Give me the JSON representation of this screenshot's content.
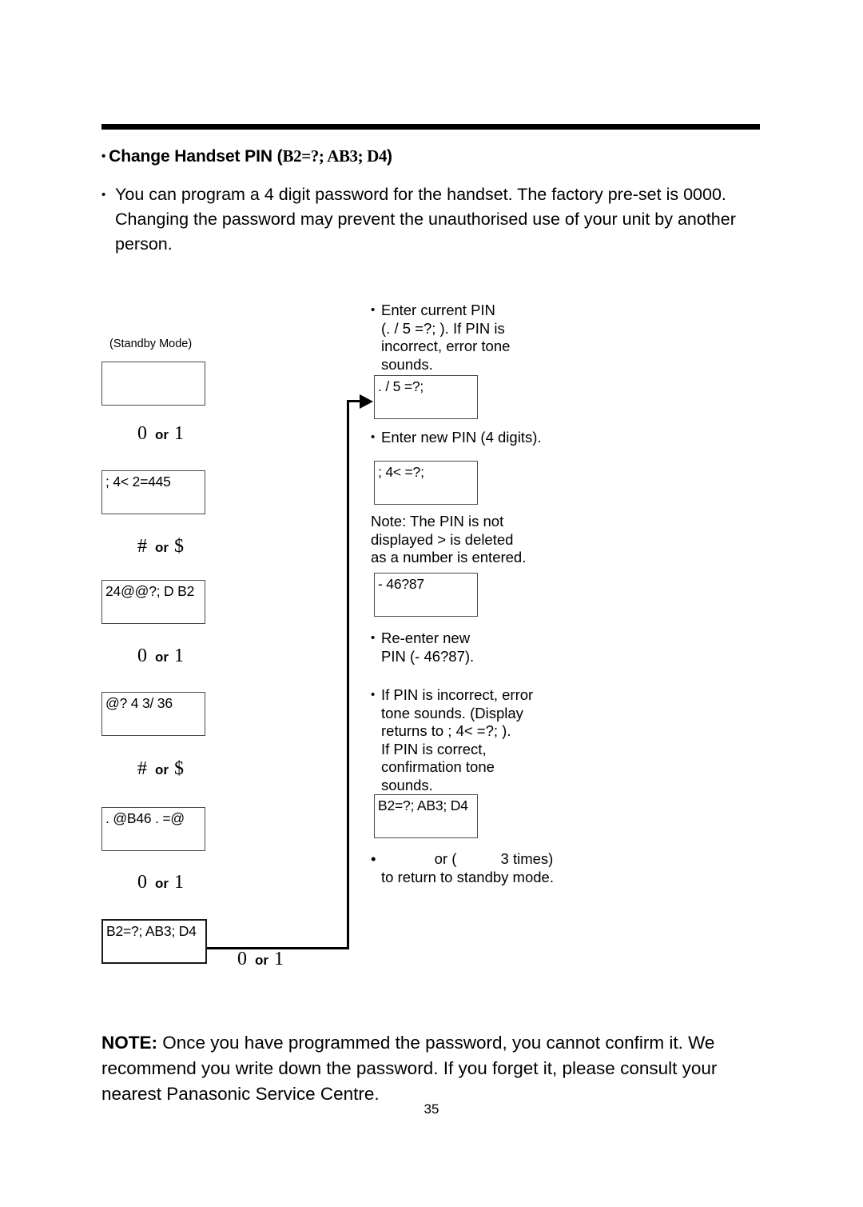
{
  "document": {
    "page_number": "35"
  },
  "header": {
    "bullet": "•",
    "title_prefix": "Change Handset PIN (",
    "title_symbols": "B2=?;   AB3; D4",
    "title_suffix": ")"
  },
  "intro": {
    "bullet": "•",
    "text": "You can program a 4 digit password for the handset. The factory pre-set is 0000. Changing the password may prevent the unauthorised use of your unit by another person."
  },
  "diagram": {
    "standby_label": "(Standby Mode)",
    "left_column": {
      "displays": [
        {
          "name": "standby-display",
          "text": ""
        },
        {
          "name": "menu-display",
          "text": "; 4< 2=445"
        },
        {
          "name": "option-display",
          "text": "24@@?; D B2"
        },
        {
          "name": "setting-display",
          "text": "@?  4 3/ 36"
        },
        {
          "name": "submenu-display",
          "text": ". @B46 . =@"
        },
        {
          "name": "handset-pin-display",
          "text": "B2=?;  AB3; D4"
        }
      ],
      "keys": [
        {
          "name": "key-step-1",
          "left": "0",
          "or": "or",
          "right": "1"
        },
        {
          "name": "key-step-2",
          "left": "#",
          "or": "or",
          "right": "$"
        },
        {
          "name": "key-step-3",
          "left": "0",
          "or": "or",
          "right": "1"
        },
        {
          "name": "key-step-4",
          "left": "#",
          "or": "or",
          "right": "$"
        },
        {
          "name": "key-step-5",
          "left": "0",
          "or": "or",
          "right": "1"
        },
        {
          "name": "key-step-6",
          "left": "0",
          "or": "or",
          "right": "1"
        }
      ]
    },
    "right_column": {
      "step_enter_current_pin": {
        "bullet": "•",
        "lines": [
          "Enter current PIN",
          "(. / 5 =?; ). If PIN is",
          "incorrect, error tone",
          "sounds."
        ]
      },
      "display_enter_pin": ". / 5  =?;",
      "step_enter_new_pin": {
        "bullet": "•",
        "lines": [
          "Enter new PIN (4 digits)."
        ]
      },
      "display_new_pin": "; 4<  =?;",
      "note_pin_not_displayed": {
        "lines": [
          "Note: The PIN is not",
          "displayed > is deleted",
          "as a number is entered."
        ]
      },
      "display_masked_pin": "- 46?87",
      "step_reenter": {
        "bullet": "•",
        "lines": [
          "Re-enter new",
          "PIN (- 46?87)."
        ]
      },
      "step_result": {
        "bullet": "•",
        "lines": [
          "If PIN is incorrect, error",
          "tone sounds. (Display",
          "returns to ; 4< =?; ).",
          "If PIN is correct,",
          "confirmation tone",
          "sounds."
        ]
      },
      "display_confirm": "B2=?;  AB3; D4",
      "step_return": {
        "bullet": "•",
        "line1_mid": "or (",
        "line1_end": "3 times)",
        "line2": "to return to standby mode."
      }
    }
  },
  "footer": {
    "note_label": "NOTE:",
    "note_text": " Once you have programmed the password, you cannot confirm it. We recommend you write down the password. If you forget it, please consult your nearest Panasonic Service Centre."
  }
}
